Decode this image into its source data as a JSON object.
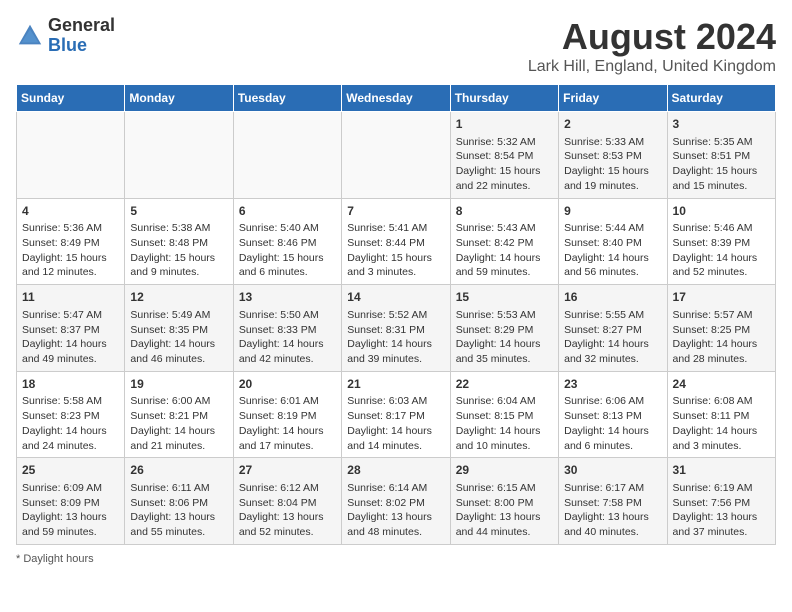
{
  "logo": {
    "general": "General",
    "blue": "Blue"
  },
  "title": "August 2024",
  "subtitle": "Lark Hill, England, United Kingdom",
  "days_of_week": [
    "Sunday",
    "Monday",
    "Tuesday",
    "Wednesday",
    "Thursday",
    "Friday",
    "Saturday"
  ],
  "footer": "Daylight hours",
  "weeks": [
    [
      {
        "day": "",
        "info": ""
      },
      {
        "day": "",
        "info": ""
      },
      {
        "day": "",
        "info": ""
      },
      {
        "day": "",
        "info": ""
      },
      {
        "day": "1",
        "sunrise": "Sunrise: 5:32 AM",
        "sunset": "Sunset: 8:54 PM",
        "daylight": "Daylight: 15 hours and 22 minutes."
      },
      {
        "day": "2",
        "sunrise": "Sunrise: 5:33 AM",
        "sunset": "Sunset: 8:53 PM",
        "daylight": "Daylight: 15 hours and 19 minutes."
      },
      {
        "day": "3",
        "sunrise": "Sunrise: 5:35 AM",
        "sunset": "Sunset: 8:51 PM",
        "daylight": "Daylight: 15 hours and 15 minutes."
      }
    ],
    [
      {
        "day": "4",
        "sunrise": "Sunrise: 5:36 AM",
        "sunset": "Sunset: 8:49 PM",
        "daylight": "Daylight: 15 hours and 12 minutes."
      },
      {
        "day": "5",
        "sunrise": "Sunrise: 5:38 AM",
        "sunset": "Sunset: 8:48 PM",
        "daylight": "Daylight: 15 hours and 9 minutes."
      },
      {
        "day": "6",
        "sunrise": "Sunrise: 5:40 AM",
        "sunset": "Sunset: 8:46 PM",
        "daylight": "Daylight: 15 hours and 6 minutes."
      },
      {
        "day": "7",
        "sunrise": "Sunrise: 5:41 AM",
        "sunset": "Sunset: 8:44 PM",
        "daylight": "Daylight: 15 hours and 3 minutes."
      },
      {
        "day": "8",
        "sunrise": "Sunrise: 5:43 AM",
        "sunset": "Sunset: 8:42 PM",
        "daylight": "Daylight: 14 hours and 59 minutes."
      },
      {
        "day": "9",
        "sunrise": "Sunrise: 5:44 AM",
        "sunset": "Sunset: 8:40 PM",
        "daylight": "Daylight: 14 hours and 56 minutes."
      },
      {
        "day": "10",
        "sunrise": "Sunrise: 5:46 AM",
        "sunset": "Sunset: 8:39 PM",
        "daylight": "Daylight: 14 hours and 52 minutes."
      }
    ],
    [
      {
        "day": "11",
        "sunrise": "Sunrise: 5:47 AM",
        "sunset": "Sunset: 8:37 PM",
        "daylight": "Daylight: 14 hours and 49 minutes."
      },
      {
        "day": "12",
        "sunrise": "Sunrise: 5:49 AM",
        "sunset": "Sunset: 8:35 PM",
        "daylight": "Daylight: 14 hours and 46 minutes."
      },
      {
        "day": "13",
        "sunrise": "Sunrise: 5:50 AM",
        "sunset": "Sunset: 8:33 PM",
        "daylight": "Daylight: 14 hours and 42 minutes."
      },
      {
        "day": "14",
        "sunrise": "Sunrise: 5:52 AM",
        "sunset": "Sunset: 8:31 PM",
        "daylight": "Daylight: 14 hours and 39 minutes."
      },
      {
        "day": "15",
        "sunrise": "Sunrise: 5:53 AM",
        "sunset": "Sunset: 8:29 PM",
        "daylight": "Daylight: 14 hours and 35 minutes."
      },
      {
        "day": "16",
        "sunrise": "Sunrise: 5:55 AM",
        "sunset": "Sunset: 8:27 PM",
        "daylight": "Daylight: 14 hours and 32 minutes."
      },
      {
        "day": "17",
        "sunrise": "Sunrise: 5:57 AM",
        "sunset": "Sunset: 8:25 PM",
        "daylight": "Daylight: 14 hours and 28 minutes."
      }
    ],
    [
      {
        "day": "18",
        "sunrise": "Sunrise: 5:58 AM",
        "sunset": "Sunset: 8:23 PM",
        "daylight": "Daylight: 14 hours and 24 minutes."
      },
      {
        "day": "19",
        "sunrise": "Sunrise: 6:00 AM",
        "sunset": "Sunset: 8:21 PM",
        "daylight": "Daylight: 14 hours and 21 minutes."
      },
      {
        "day": "20",
        "sunrise": "Sunrise: 6:01 AM",
        "sunset": "Sunset: 8:19 PM",
        "daylight": "Daylight: 14 hours and 17 minutes."
      },
      {
        "day": "21",
        "sunrise": "Sunrise: 6:03 AM",
        "sunset": "Sunset: 8:17 PM",
        "daylight": "Daylight: 14 hours and 14 minutes."
      },
      {
        "day": "22",
        "sunrise": "Sunrise: 6:04 AM",
        "sunset": "Sunset: 8:15 PM",
        "daylight": "Daylight: 14 hours and 10 minutes."
      },
      {
        "day": "23",
        "sunrise": "Sunrise: 6:06 AM",
        "sunset": "Sunset: 8:13 PM",
        "daylight": "Daylight: 14 hours and 6 minutes."
      },
      {
        "day": "24",
        "sunrise": "Sunrise: 6:08 AM",
        "sunset": "Sunset: 8:11 PM",
        "daylight": "Daylight: 14 hours and 3 minutes."
      }
    ],
    [
      {
        "day": "25",
        "sunrise": "Sunrise: 6:09 AM",
        "sunset": "Sunset: 8:09 PM",
        "daylight": "Daylight: 13 hours and 59 minutes."
      },
      {
        "day": "26",
        "sunrise": "Sunrise: 6:11 AM",
        "sunset": "Sunset: 8:06 PM",
        "daylight": "Daylight: 13 hours and 55 minutes."
      },
      {
        "day": "27",
        "sunrise": "Sunrise: 6:12 AM",
        "sunset": "Sunset: 8:04 PM",
        "daylight": "Daylight: 13 hours and 52 minutes."
      },
      {
        "day": "28",
        "sunrise": "Sunrise: 6:14 AM",
        "sunset": "Sunset: 8:02 PM",
        "daylight": "Daylight: 13 hours and 48 minutes."
      },
      {
        "day": "29",
        "sunrise": "Sunrise: 6:15 AM",
        "sunset": "Sunset: 8:00 PM",
        "daylight": "Daylight: 13 hours and 44 minutes."
      },
      {
        "day": "30",
        "sunrise": "Sunrise: 6:17 AM",
        "sunset": "Sunset: 7:58 PM",
        "daylight": "Daylight: 13 hours and 40 minutes."
      },
      {
        "day": "31",
        "sunrise": "Sunrise: 6:19 AM",
        "sunset": "Sunset: 7:56 PM",
        "daylight": "Daylight: 13 hours and 37 minutes."
      }
    ]
  ]
}
